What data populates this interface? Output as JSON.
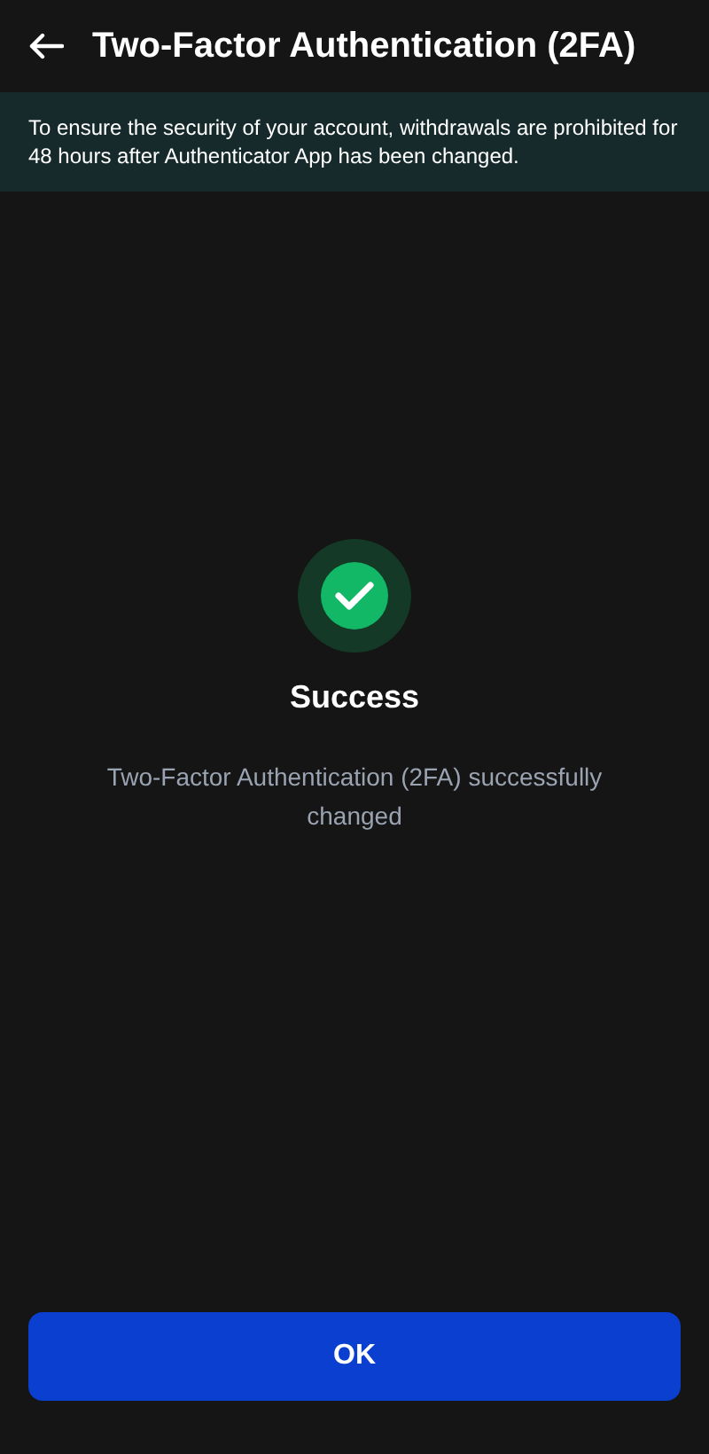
{
  "header": {
    "title": "Two-Factor Authentication (2FA)"
  },
  "notice": {
    "text": "To ensure the security of your account, withdrawals are prohibited for 48 hours after Authenticator App has been changed."
  },
  "result": {
    "title": "Success",
    "message": "Two-Factor Authentication (2FA) successfully changed"
  },
  "buttons": [
    "OK"
  ]
}
